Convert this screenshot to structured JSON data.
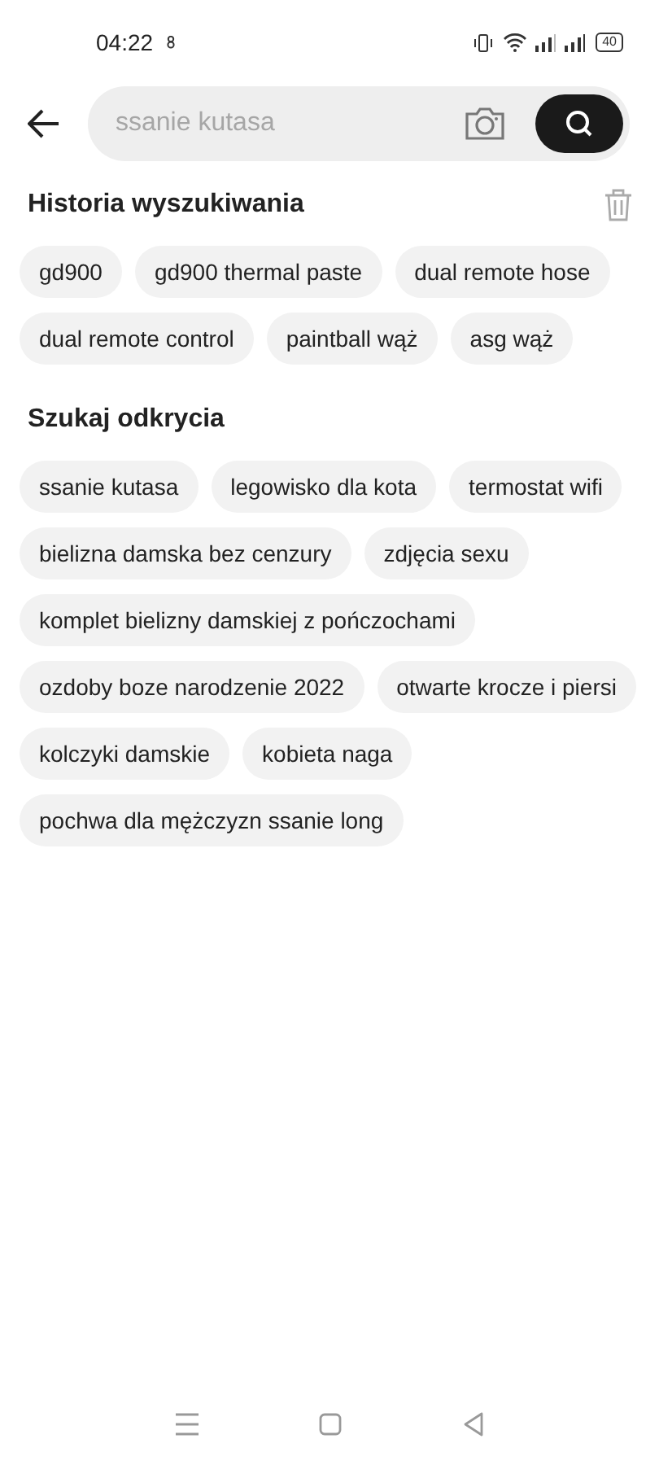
{
  "status_bar": {
    "time": "04:22",
    "battery": "40"
  },
  "search": {
    "placeholder": "ssanie kutasa"
  },
  "history": {
    "title": "Historia wyszukiwania",
    "items": [
      "gd900",
      "gd900 thermal paste",
      "dual remote hose",
      "dual remote control",
      "paintball wąż",
      "asg wąż"
    ]
  },
  "discover": {
    "title": "Szukaj odkrycia",
    "items": [
      "ssanie kutasa",
      "legowisko dla kota",
      "termostat wifi",
      "bielizna damska bez cenzury",
      "zdjęcia sexu",
      "komplet bielizny damskiej z pończochami",
      "ozdoby boze narodzenie 2022",
      "otwarte krocze i piersi",
      "kolczyki damskie",
      "kobieta naga",
      "pochwa dla mężczyzn ssanie long"
    ]
  }
}
